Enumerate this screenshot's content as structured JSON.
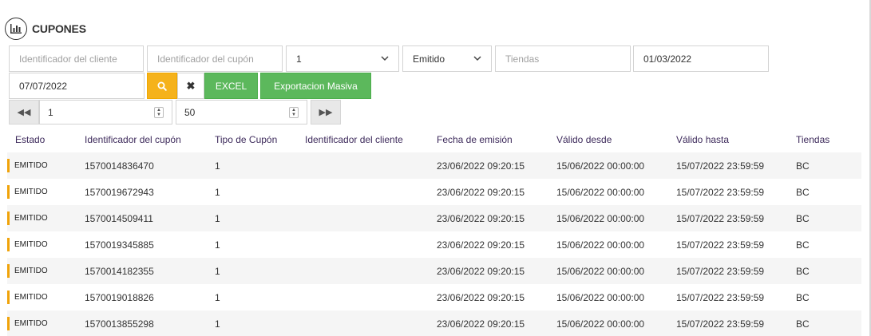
{
  "header": {
    "title": "CUPONES",
    "icon": "bar-chart-icon"
  },
  "filters": {
    "customer_id_placeholder": "Identificador del cliente",
    "coupon_id_placeholder": "Identificador del cupón",
    "type_value": "1",
    "status_value": "Emitido",
    "stores_placeholder": "Tiendas",
    "date_from": "01/03/2022",
    "date_to": "07/07/2022"
  },
  "actions": {
    "excel_label": "EXCEL",
    "mass_export_label": "Exportacion Masiva"
  },
  "pager": {
    "page": "1",
    "page_size": "50"
  },
  "table": {
    "columns": [
      "Estado",
      "Identificador del cupón",
      "Tipo de Cupón",
      "Identificador del cliente",
      "Fecha de emisión",
      "Válido desde",
      "Válido hasta",
      "Tiendas"
    ],
    "rows": [
      {
        "status": "EMITIDO",
        "coupon_id": "1570014836470",
        "type": "1",
        "customer_id": "",
        "issued": "23/06/2022 09:20:15",
        "valid_from": "15/06/2022 00:00:00",
        "valid_to": "15/07/2022 23:59:59",
        "stores": "BC"
      },
      {
        "status": "EMITIDO",
        "coupon_id": "1570019672943",
        "type": "1",
        "customer_id": "",
        "issued": "23/06/2022 09:20:15",
        "valid_from": "15/06/2022 00:00:00",
        "valid_to": "15/07/2022 23:59:59",
        "stores": "BC"
      },
      {
        "status": "EMITIDO",
        "coupon_id": "1570014509411",
        "type": "1",
        "customer_id": "",
        "issued": "23/06/2022 09:20:15",
        "valid_from": "15/06/2022 00:00:00",
        "valid_to": "15/07/2022 23:59:59",
        "stores": "BC"
      },
      {
        "status": "EMITIDO",
        "coupon_id": "1570019345885",
        "type": "1",
        "customer_id": "",
        "issued": "23/06/2022 09:20:15",
        "valid_from": "15/06/2022 00:00:00",
        "valid_to": "15/07/2022 23:59:59",
        "stores": "BC"
      },
      {
        "status": "EMITIDO",
        "coupon_id": "1570014182355",
        "type": "1",
        "customer_id": "",
        "issued": "23/06/2022 09:20:15",
        "valid_from": "15/06/2022 00:00:00",
        "valid_to": "15/07/2022 23:59:59",
        "stores": "BC"
      },
      {
        "status": "EMITIDO",
        "coupon_id": "1570019018826",
        "type": "1",
        "customer_id": "",
        "issued": "23/06/2022 09:20:15",
        "valid_from": "15/06/2022 00:00:00",
        "valid_to": "15/07/2022 23:59:59",
        "stores": "BC"
      },
      {
        "status": "EMITIDO",
        "coupon_id": "1570013855298",
        "type": "1",
        "customer_id": "",
        "issued": "23/06/2022 09:20:15",
        "valid_from": "15/06/2022 00:00:00",
        "valid_to": "15/07/2022 23:59:59",
        "stores": "BC"
      }
    ]
  },
  "colors": {
    "accent_orange": "#f5b21b",
    "green": "#5cb85c",
    "status_bar": "#f0a30a",
    "header_text": "#3d2a5b"
  }
}
